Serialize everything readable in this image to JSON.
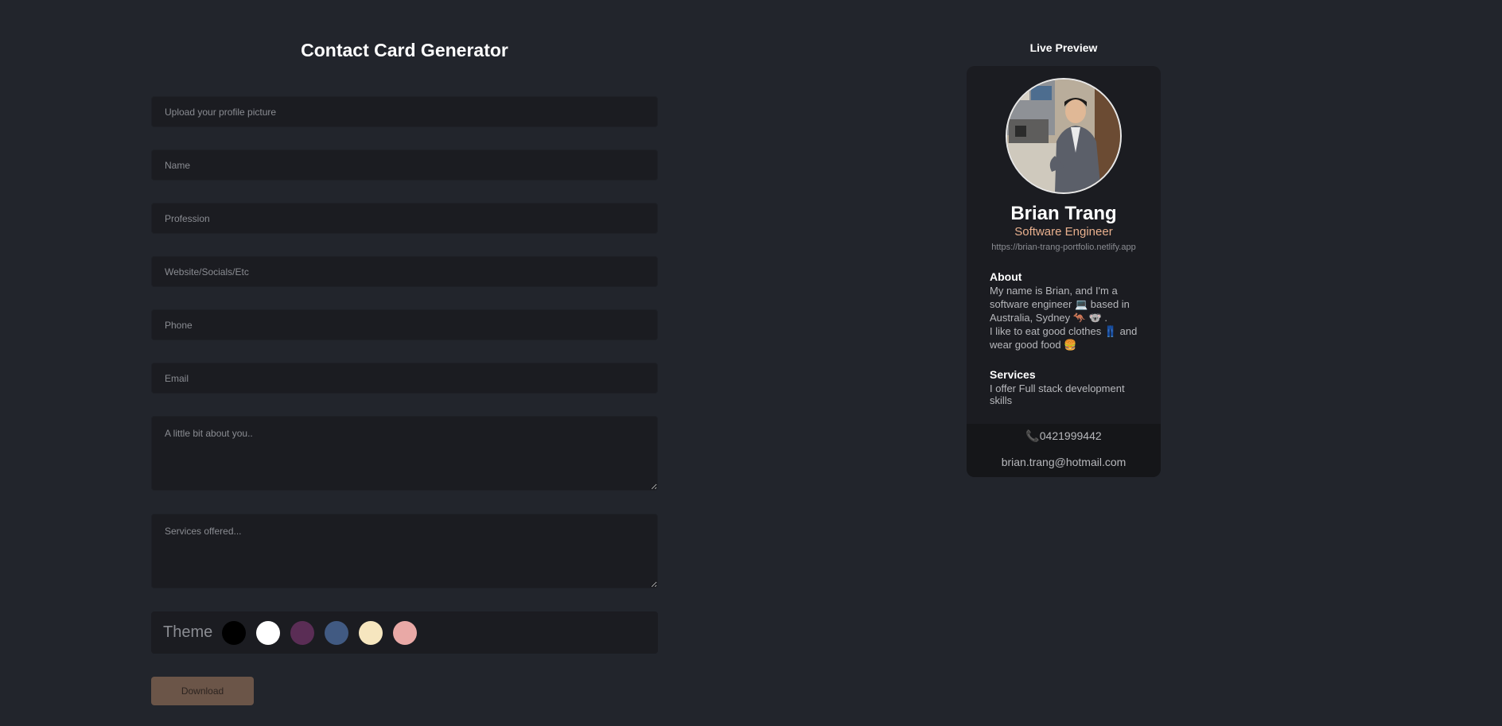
{
  "form": {
    "title": "Contact Card Generator",
    "upload_placeholder": "Upload your profile picture",
    "name_placeholder": "Name",
    "profession_placeholder": "Profession",
    "website_placeholder": "Website/Socials/Etc",
    "phone_placeholder": "Phone",
    "email_placeholder": "Email",
    "about_placeholder": "A little bit about you..",
    "services_placeholder": "Services offered...",
    "theme_label": "Theme",
    "theme_colors": [
      "#000000",
      "#ffffff",
      "#5a2d55",
      "#415a82",
      "#f6e6bf",
      "#e9a9a6"
    ],
    "download_label": "Download"
  },
  "preview": {
    "title": "Live Preview",
    "name": "Brian Trang",
    "profession": "Software Engineer",
    "website": "https://brian-trang-portfolio.netlify.app",
    "about_heading": "About",
    "about_text": "My name is Brian, and I'm a software engineer 💻 based in Australia, Sydney 🦘 🐨 .\nI like to eat good clothes 👖 and wear good food 🍔",
    "services_heading": "Services",
    "services_text": "I offer Full stack development skills",
    "phone": "📞0421999442",
    "email": "brian.trang@hotmail.com",
    "accent_color": "#e8b08e"
  }
}
